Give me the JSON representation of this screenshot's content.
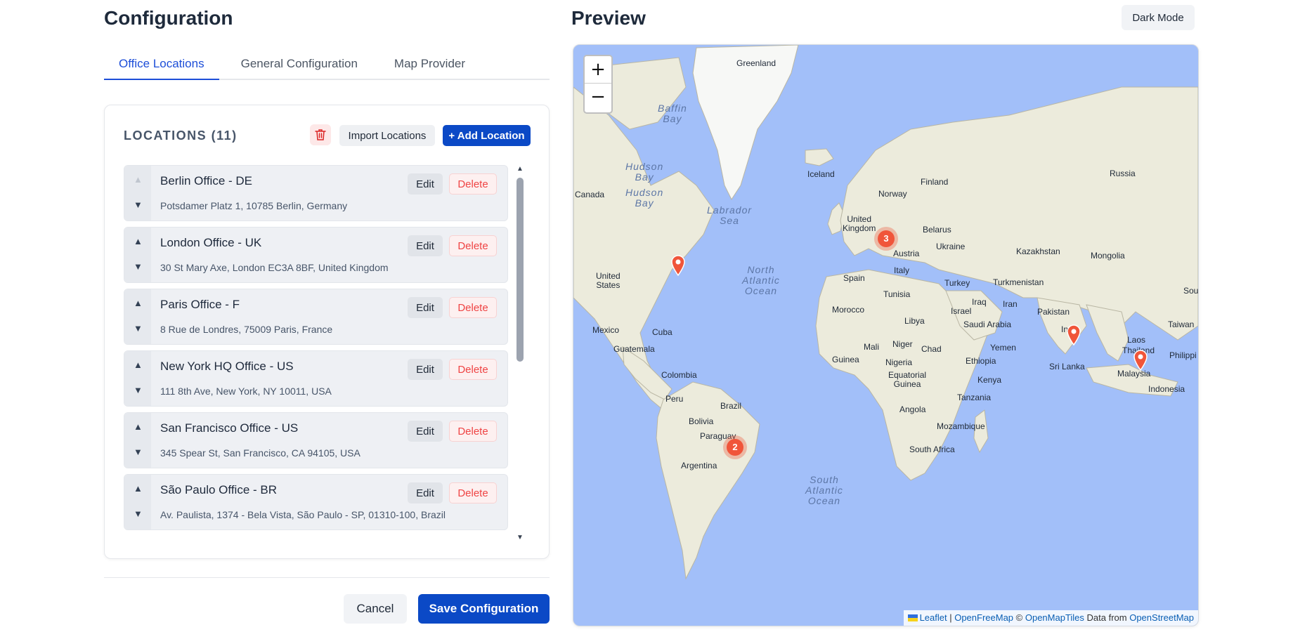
{
  "config": {
    "title": "Configuration",
    "tabs": [
      {
        "label": "Office Locations",
        "active": true
      },
      {
        "label": "General Configuration",
        "active": false
      },
      {
        "label": "Map Provider",
        "active": false
      }
    ],
    "locations_heading": "LOCATIONS (11)",
    "import_label": "Import Locations",
    "add_label": "+ Add Location",
    "edit_label": "Edit",
    "delete_label": "Delete",
    "locations": [
      {
        "name": "Berlin Office - DE",
        "address": "Potsdamer Platz 1, 10785 Berlin, Germany"
      },
      {
        "name": "London Office - UK",
        "address": "30 St Mary Axe, London EC3A 8BF, United Kingdom"
      },
      {
        "name": "Paris Office - F",
        "address": "8 Rue de Londres, 75009 Paris, France"
      },
      {
        "name": "New York HQ Office - US",
        "address": "111 8th Ave, New York, NY 10011, USA"
      },
      {
        "name": "San Francisco Office - US",
        "address": "345 Spear St, San Francisco, CA 94105, USA"
      },
      {
        "name": "São Paulo Office - BR",
        "address": "Av. Paulista, 1374 - Bela Vista, São Paulo - SP, 01310-100, Brazil"
      }
    ],
    "cancel_label": "Cancel",
    "save_label": "Save Configuration"
  },
  "preview": {
    "title": "Preview",
    "dark_mode_label": "Dark Mode",
    "zoom_in": "+",
    "zoom_out": "−",
    "clusters": [
      "3",
      "2"
    ],
    "labels": {
      "greenland": "Greenland",
      "baffin": "Baffin\nBay",
      "hudson": "Hudson\nBay",
      "hudson2": "Hudson\nBay",
      "canada": "Canada",
      "labrador": "Labrador\nSea",
      "iceland": "Iceland",
      "finland": "Finland",
      "norway": "Norway",
      "russia": "Russia",
      "uk": "United\nKingdom",
      "belarus": "Belarus",
      "ukraine": "Ukraine",
      "austria": "Austria",
      "italy": "Italy",
      "kazakhstan": "Kazakhstan",
      "mongolia": "Mongolia",
      "us": "United\nStates",
      "natl": "North\nAtlantic\nOcean",
      "spain": "Spain",
      "turkey": "Turkey",
      "turkmenistan": "Turkmenistan",
      "south": "South",
      "tunisia": "Tunisia",
      "morocco": "Morocco",
      "iraq": "Iraq",
      "israel": "Israel",
      "iran": "Iran",
      "pakistan": "Pakistan",
      "libya": "Libya",
      "saudi": "Saudi Arabia",
      "mexico": "Mexico",
      "cuba": "Cuba",
      "taiwan": "Taiwan",
      "india": "India",
      "laos": "Laos",
      "guatemala": "Guatemala",
      "mali": "Mali",
      "niger": "Niger",
      "chad": "Chad",
      "yemen": "Yemen",
      "thailand": "Thailand",
      "philippines": "Philippi",
      "guinea": "Guinea",
      "nigeria": "Nigeria",
      "ethiopia": "Ethiopia",
      "srilanka": "Sri Lanka",
      "malaysia": "Malaysia",
      "colombia": "Colombia",
      "eqguinea": "Equatorial\nGuinea",
      "kenya": "Kenya",
      "indonesia": "Indonesia",
      "peru": "Peru",
      "brazil": "Brazil",
      "tanzania": "Tanzania",
      "angola": "Angola",
      "bolivia": "Bolivia",
      "mozambique": "Mozambique",
      "paraguay": "Paraguay",
      "argentina": "Argentina",
      "southafrica": "South Africa",
      "satl": "South\nAtlantic\nOcean"
    },
    "attribution": {
      "leaflet": "Leaflet",
      "sep": " | ",
      "ofm": "OpenFreeMap",
      "copy": " © ",
      "omt": "OpenMapTiles",
      "data_from": " Data from ",
      "osm": "OpenStreetMap"
    }
  },
  "colors": {
    "accent": "#0b49c6",
    "danger": "#ef4444",
    "water": "#a2bff9",
    "land": "#ecebdc",
    "marker": "#f0553a"
  }
}
